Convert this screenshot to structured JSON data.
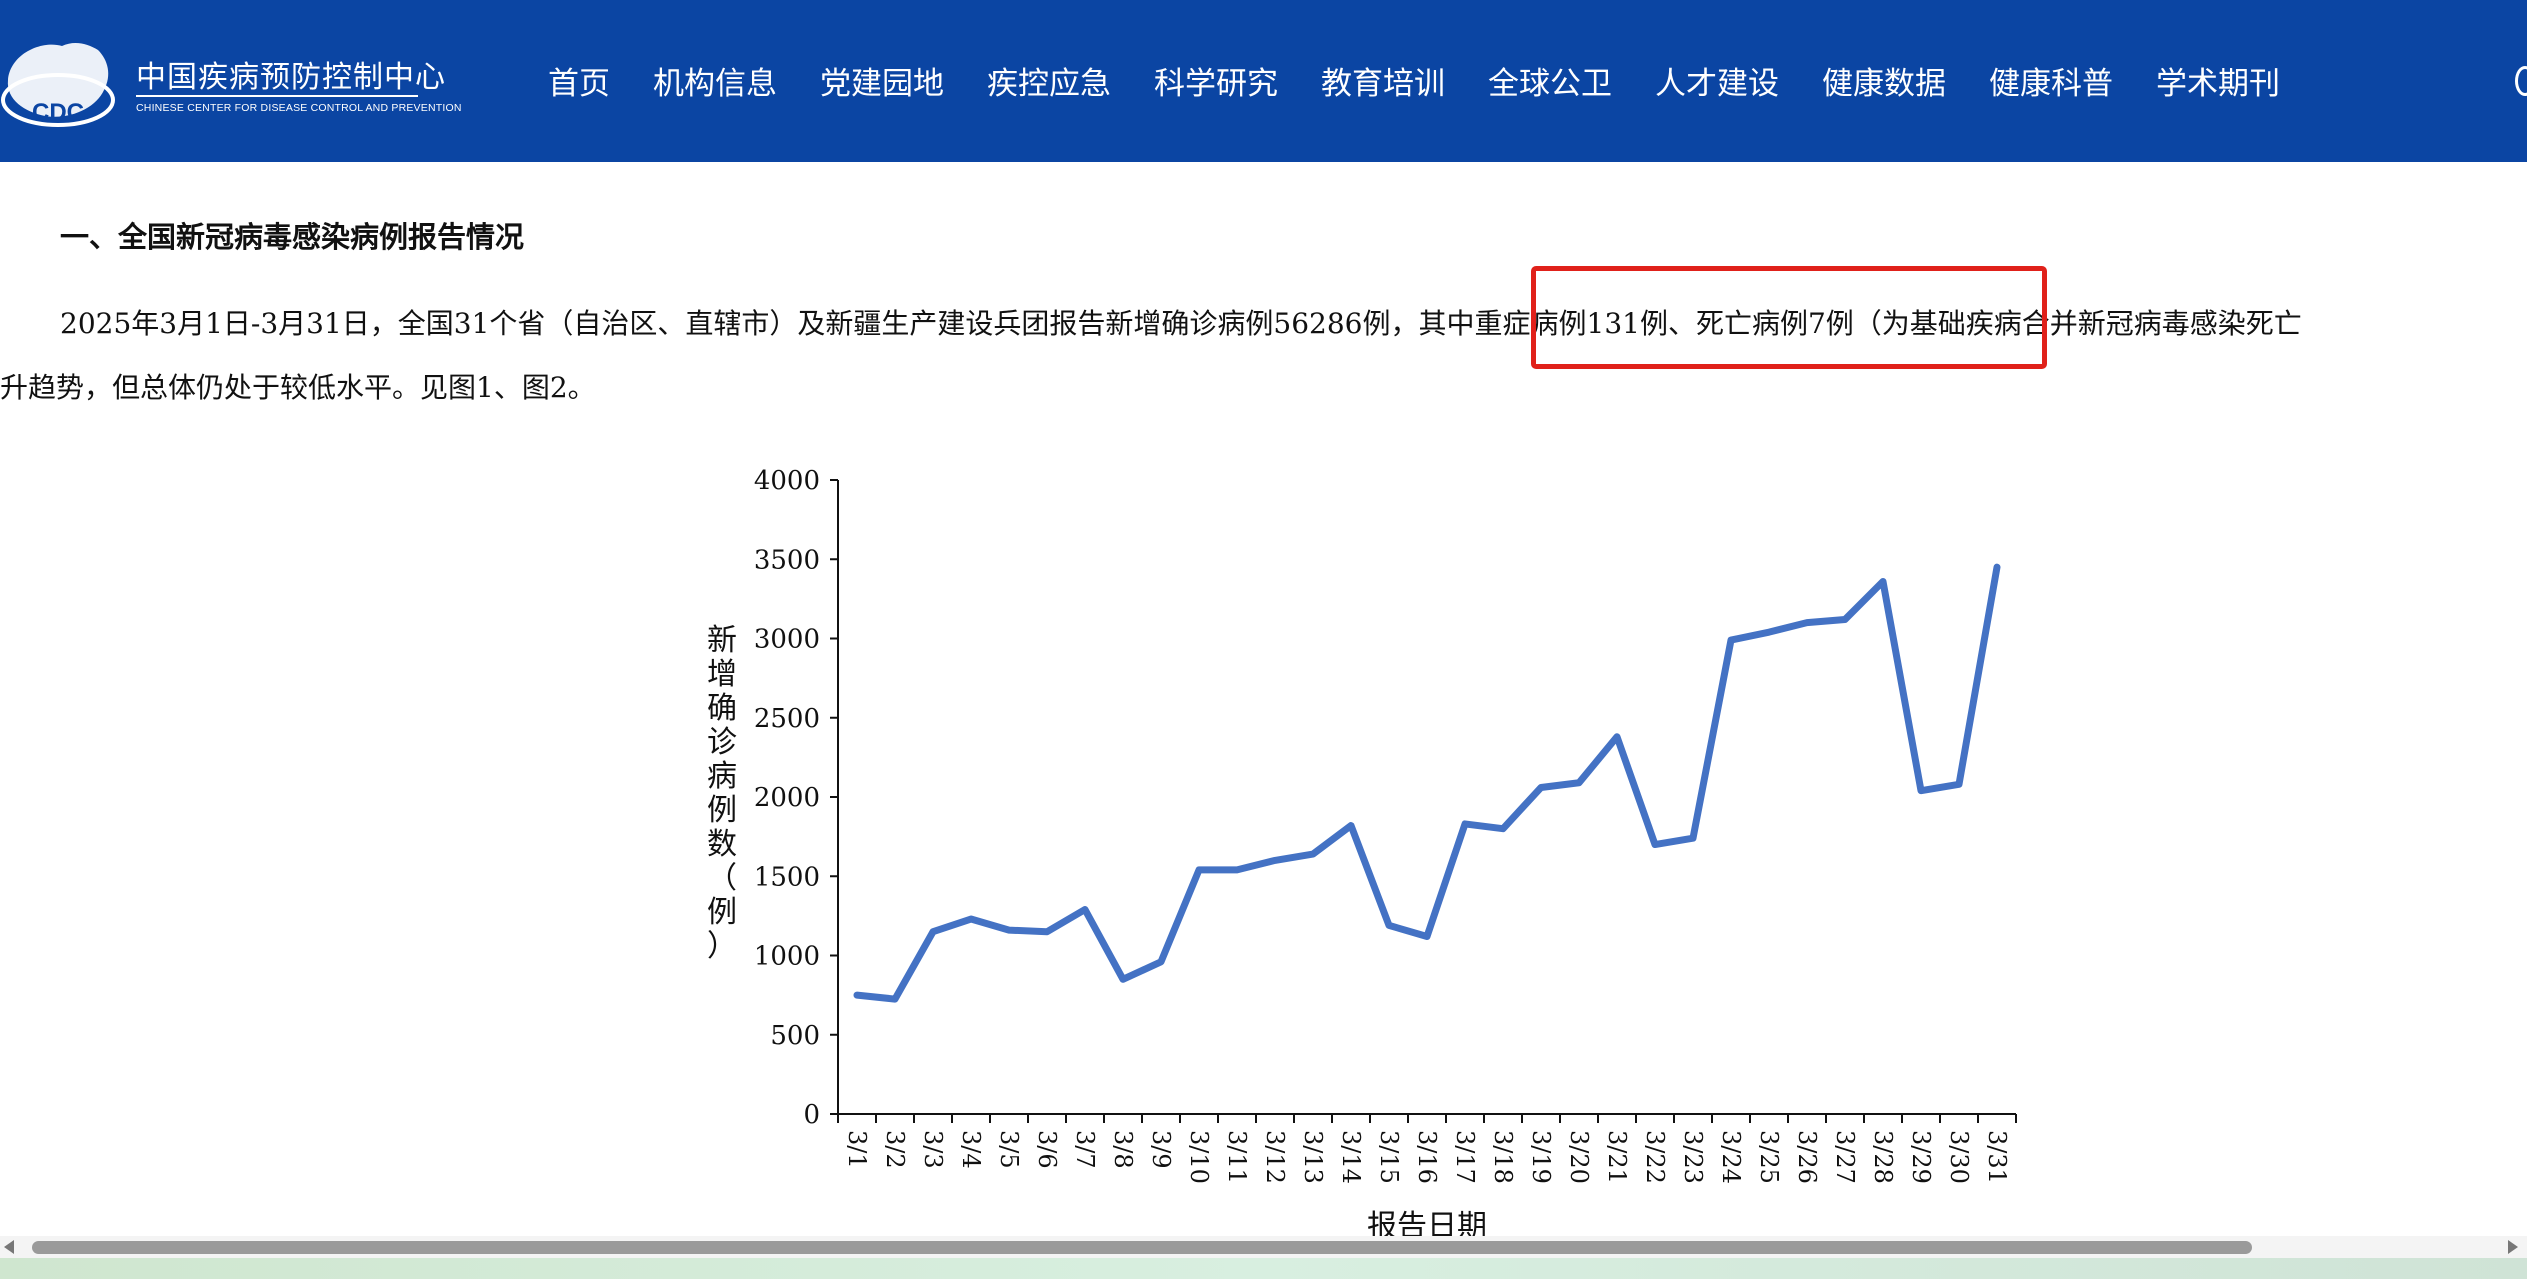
{
  "header": {
    "logo_badge": "CDC",
    "logo_cn": "中国疾病预防控制中心",
    "logo_en": "CHINESE CENTER FOR DISEASE CONTROL AND PREVENTION",
    "nav": [
      "首页",
      "机构信息",
      "党建园地",
      "疾控应急",
      "科学研究",
      "教育培训",
      "全球公卫",
      "人才建设",
      "健康数据",
      "健康科普",
      "学术期刊"
    ],
    "colors": {
      "bar": "#0b45a3"
    }
  },
  "article": {
    "section_title": "一、全国新冠病毒感染病例报告情况",
    "para_line1_a": "2025年3月1日-3月31日，全国31个省（自治区、直辖市）及新疆生产建设兵团报告新增确诊病例56286例，",
    "para_line1_highlight": "其中重症病例131例、死亡病例7例",
    "para_line1_b": "（为基础疾病合并新冠病毒感染死亡",
    "para_line2": "升趋势，但总体仍处于较低水平。见图1、图2。",
    "highlight_color": "#e0211a"
  },
  "chart_data": {
    "type": "line",
    "title": "",
    "xlabel": "报告日期",
    "ylabel": "新增确诊病例数（例）",
    "ylim": [
      0,
      4000
    ],
    "yticks": [
      0,
      500,
      1000,
      1500,
      2000,
      2500,
      3000,
      3500,
      4000
    ],
    "categories": [
      "3/1",
      "3/2",
      "3/3",
      "3/4",
      "3/5",
      "3/6",
      "3/7",
      "3/8",
      "3/9",
      "3/10",
      "3/11",
      "3/12",
      "3/13",
      "3/14",
      "3/15",
      "3/16",
      "3/17",
      "3/18",
      "3/19",
      "3/20",
      "3/21",
      "3/22",
      "3/23",
      "3/24",
      "3/25",
      "3/26",
      "3/27",
      "3/28",
      "3/29",
      "3/30",
      "3/31"
    ],
    "series": [
      {
        "color": "#4472c4",
        "values": [
          750,
          725,
          1150,
          1230,
          1160,
          1150,
          1290,
          850,
          960,
          1540,
          1540,
          1600,
          1640,
          1820,
          1190,
          1120,
          1830,
          1800,
          2060,
          2090,
          2380,
          1700,
          1740,
          2990,
          3040,
          3100,
          3120,
          3360,
          2040,
          2080,
          3450
        ]
      }
    ],
    "grid": false,
    "legend": "none"
  }
}
